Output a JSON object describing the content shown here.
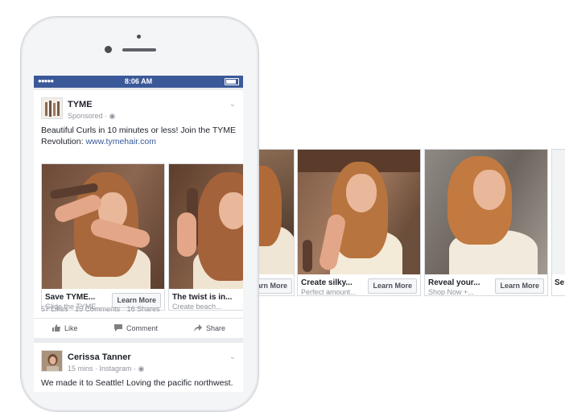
{
  "status_bar": {
    "signal": "●●●●●",
    "time": "8:06 AM"
  },
  "post1": {
    "author": "TYME",
    "meta": "Sponsored · ",
    "text": "Beautiful Curls in 10 minutes or less! Join the TYME Revolution: ",
    "link": "www.tymehair.com",
    "chevron": "⌄",
    "cards": [
      {
        "title": "Save TYME...",
        "subtitle": "Glide the TYME...",
        "cta": "Learn More"
      },
      {
        "title": "The twist is in...",
        "subtitle": "Create beach...",
        "cta": "Learn More"
      },
      {
        "title": "Create silky...",
        "subtitle": "Perfect amount...",
        "cta": "Learn More"
      },
      {
        "title": "Reveal your...",
        "subtitle": "Shop Now +...",
        "cta": "Learn More"
      },
      {
        "title": "Se",
        "subtitle": "",
        "cta": ""
      }
    ],
    "stats": {
      "likes": "57 Likes",
      "comments": "15 Comments",
      "shares": "16 Shares"
    },
    "actions": {
      "like": "Like",
      "comment": "Comment",
      "share": "Share"
    }
  },
  "post2": {
    "author": "Cerissa Tanner",
    "meta": "15 mins · Instagram · ",
    "text": "We made it to Seattle! Loving the pacific northwest.",
    "chevron": "⌄"
  },
  "colors": {
    "fb_blue": "#3b5998",
    "link": "#365899"
  }
}
